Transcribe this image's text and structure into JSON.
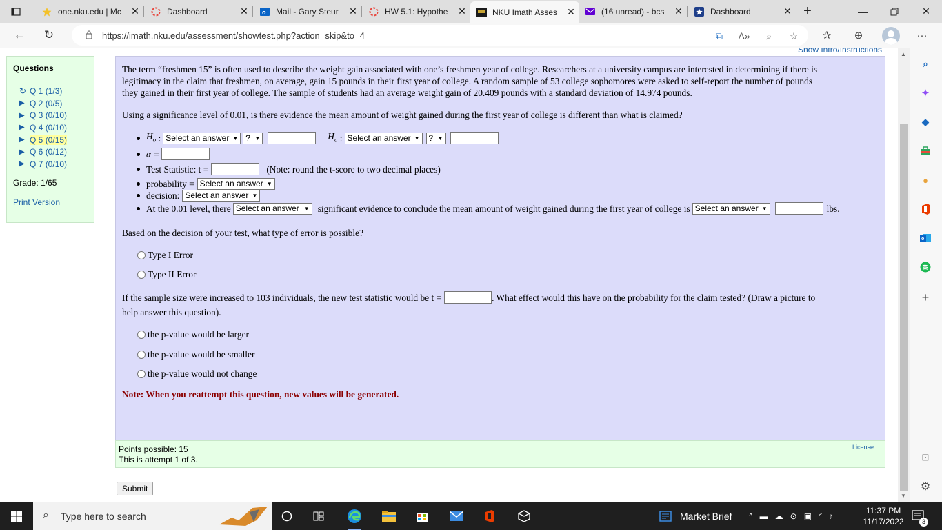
{
  "browser": {
    "tabs": [
      {
        "label": "one.nku.edu | Mc",
        "icon": "star-icon",
        "active": false
      },
      {
        "label": "Dashboard",
        "icon": "circle-icon",
        "active": false
      },
      {
        "label": "Mail - Gary Steur",
        "icon": "outlook-icon",
        "active": false
      },
      {
        "label": "HW 5.1: Hypothe",
        "icon": "circle-icon",
        "active": false
      },
      {
        "label": "NKU Imath Asses",
        "icon": "imath-icon",
        "active": true
      },
      {
        "label": "(16 unread) - bcs",
        "icon": "yahoo-mail-icon",
        "active": false
      },
      {
        "label": "Dashboard",
        "icon": "blackboard-icon",
        "active": false
      }
    ],
    "new_tab": "+",
    "url": "https://imath.nku.edu/assessment/showtest.php?action=skip&to=4"
  },
  "page": {
    "show_intro": "Show Intro/Instructions",
    "sidebar": {
      "title": "Questions",
      "questions": [
        {
          "label": "Q 1",
          "score": "(1/3)",
          "marker": "retry"
        },
        {
          "label": "Q 2",
          "score": "(0/5)",
          "marker": "arrow"
        },
        {
          "label": "Q 3",
          "score": "(0/10)",
          "marker": "arrow"
        },
        {
          "label": "Q 4",
          "score": "(0/10)",
          "marker": "arrow"
        },
        {
          "label": "Q 5",
          "score": "(0/15)",
          "marker": "arrow",
          "current": true
        },
        {
          "label": "Q 6",
          "score": "(0/12)",
          "marker": "arrow"
        },
        {
          "label": "Q 7",
          "score": "(0/10)",
          "marker": "arrow"
        }
      ],
      "grade": "Grade: 1/65",
      "print_version": "Print Version"
    },
    "question": {
      "intro_lines": [
        "The term “freshmen 15” is often used to describe the weight gain associated with one’s freshmen year of college.  Researchers at a university campus are interested in determining if there is",
        "legitimacy in the claim that freshmen, on average, gain 15 pounds in their first year of college.  A random sample of 53 college sophomores were asked to self-report the number of pounds",
        "they gained in their first year of college.  The sample of students had an average weight gain of 20.409 pounds with a standard deviation of 14.974 pounds."
      ],
      "prompt": "Using a significance level of 0.01, is there evidence the mean amount of weight gained during the first year of college is different than what is claimed?",
      "h0_label": "H",
      "h0_sub": "o",
      "ha_label": "H",
      "ha_sub": "a",
      "colon": ":",
      "select_placeholder": "Select an answer",
      "op_placeholder": "?",
      "alpha_label": "α =",
      "test_stat_label": "Test Statistic: t =",
      "test_stat_note": "(Note: round the t-score to two decimal places)",
      "probability_label": "probability =",
      "decision_label": "decision:",
      "conclusion_pre": "At the 0.01 level, there",
      "conclusion_mid": "significant evidence to conclude the mean amount of weight gained during the first year of college is",
      "conclusion_unit": "lbs.",
      "error_question": "Based on the decision of your test, what type of error is possible?",
      "error_options": [
        "Type I Error",
        "Type II Error"
      ],
      "sample_q_pre": "If the sample size were increased to 103 individuals, the new test statistic would be t =",
      "sample_q_post": ". What effect would this have on the probability for the claim tested? (Draw a picture to",
      "sample_q_line2": "help answer this question).",
      "pvalue_options": [
        "the p-value would be larger",
        "the p-value would be smaller",
        "the p-value would not change"
      ],
      "note": "Note: When you reattempt this question, new values will be generated."
    },
    "points": {
      "possible": "Points possible: 15",
      "attempt": "This is attempt 1 of 3.",
      "license": "License"
    },
    "submit": "Submit"
  },
  "taskbar": {
    "search_placeholder": "Type here to search",
    "market": "Market Brief",
    "time": "11:37 PM",
    "date": "11/17/2022",
    "notifications": "3"
  },
  "colors": {
    "question_bg": "#dcdcfa",
    "panel_bg": "#e6ffe6",
    "link": "#1a5ea6",
    "note": "#8b0000",
    "taskbar": "#1f1f1f"
  }
}
